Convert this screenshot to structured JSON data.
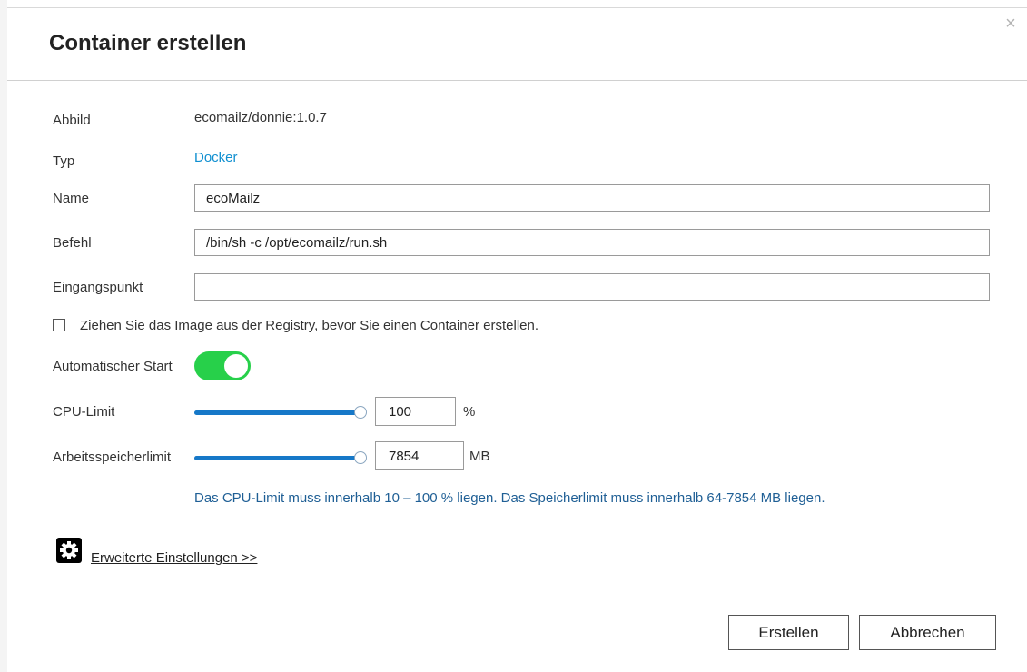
{
  "dialog": {
    "title": "Container erstellen",
    "close_symbol": "×"
  },
  "fields": {
    "image_label": "Abbild",
    "image_value": "ecomailz/donnie:1.0.7",
    "type_label": "Typ",
    "type_value": "Docker",
    "name_label": "Name",
    "name_value": "ecoMailz",
    "command_label": "Befehl",
    "command_value": "/bin/sh -c /opt/ecomailz/run.sh",
    "entrypoint_label": "Eingangspunkt",
    "entrypoint_value": ""
  },
  "pull_image": {
    "label": "Ziehen Sie das Image aus der Registry, bevor Sie einen Container erstellen.",
    "checked": false
  },
  "autostart": {
    "label": "Automatischer Start",
    "on": true,
    "color": "#27d04a"
  },
  "cpu_limit": {
    "label": "CPU-Limit",
    "value": "100",
    "unit": "%",
    "fraction": 1.0
  },
  "memory_limit": {
    "label": "Arbeitsspeicherlimit",
    "value": "7854",
    "unit": "MB",
    "fraction": 1.0
  },
  "hint": "Das CPU-Limit muss innerhalb 10 – 100 % liegen. Das Speicherlimit muss innerhalb 64-7854 MB liegen.",
  "advanced": {
    "icon": "gear-icon",
    "label": "Erweiterte Einstellungen >>"
  },
  "buttons": {
    "create": "Erstellen",
    "cancel": "Abbrechen"
  },
  "colors": {
    "accent_blue": "#1678c8",
    "link_blue": "#0f8fd0",
    "hint_blue": "#1f5f95"
  }
}
